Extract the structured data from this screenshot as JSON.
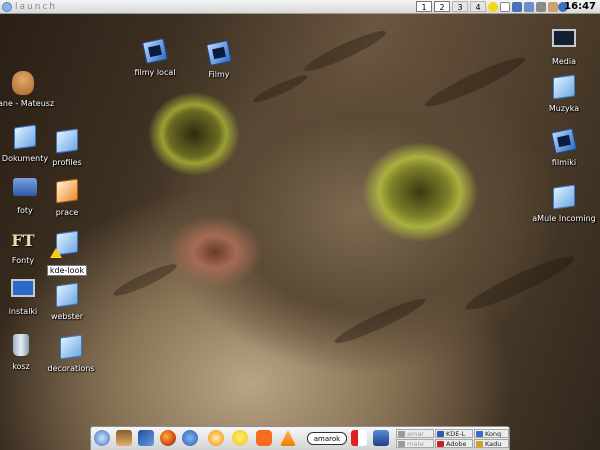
{
  "top_panel": {
    "launch_label": "launch",
    "desktops": [
      "1",
      "2",
      "3",
      "4"
    ],
    "active_desktop": "2",
    "clock": "16:47",
    "tray_icons": [
      "smiley-icon",
      "notes-icon",
      "volume-icon",
      "network-icon",
      "printer-icon",
      "clipboard-icon",
      "globe-icon"
    ]
  },
  "desktop_icons": [
    {
      "label": "Dane - Mateusz",
      "icon": "teddy-bear-icon"
    },
    {
      "label": "Dokumenty",
      "icon": "folder-icon"
    },
    {
      "label": "profiles",
      "icon": "folder-icon"
    },
    {
      "label": "foty",
      "icon": "camera-icon"
    },
    {
      "label": "prace",
      "icon": "folder-icon"
    },
    {
      "label": "Fonty",
      "icon": "fonts-icon"
    },
    {
      "label": "kde-look",
      "icon": "folder-warning-icon"
    },
    {
      "label": "instalki",
      "icon": "computer-icon"
    },
    {
      "label": "webster",
      "icon": "folder-icon"
    },
    {
      "label": "kosz",
      "icon": "trash-icon"
    },
    {
      "label": "decorations",
      "icon": "folder-icon"
    },
    {
      "label": "filmy local",
      "icon": "film-folder-icon"
    },
    {
      "label": "Filmy",
      "icon": "film-folder-icon"
    },
    {
      "label": "Media",
      "icon": "monitor-icon"
    },
    {
      "label": "Muzyka",
      "icon": "folder-icon"
    },
    {
      "label": "filmiki",
      "icon": "film-folder-icon"
    },
    {
      "label": "aMule Incoming",
      "icon": "folder-icon"
    }
  ],
  "taskbar": {
    "quick_launch": [
      "kde-menu-icon",
      "wizard-icon",
      "bird-icon",
      "firefox-icon",
      "thunderbird-icon",
      "sun-icon",
      "smiley-icon",
      "skype-icon",
      "vlc-icon",
      "amarok-icon",
      "flag-icon",
      "gimp-icon"
    ],
    "amarok_label": "amarok",
    "tasks": [
      "amar",
      "KDE-L",
      "Konq",
      "mate",
      "Adobe",
      "Kadu"
    ]
  },
  "colors": {
    "panel": "#d9d9d9",
    "icon_label": "#ffffff",
    "folder_blue": "#6fa9e6"
  }
}
